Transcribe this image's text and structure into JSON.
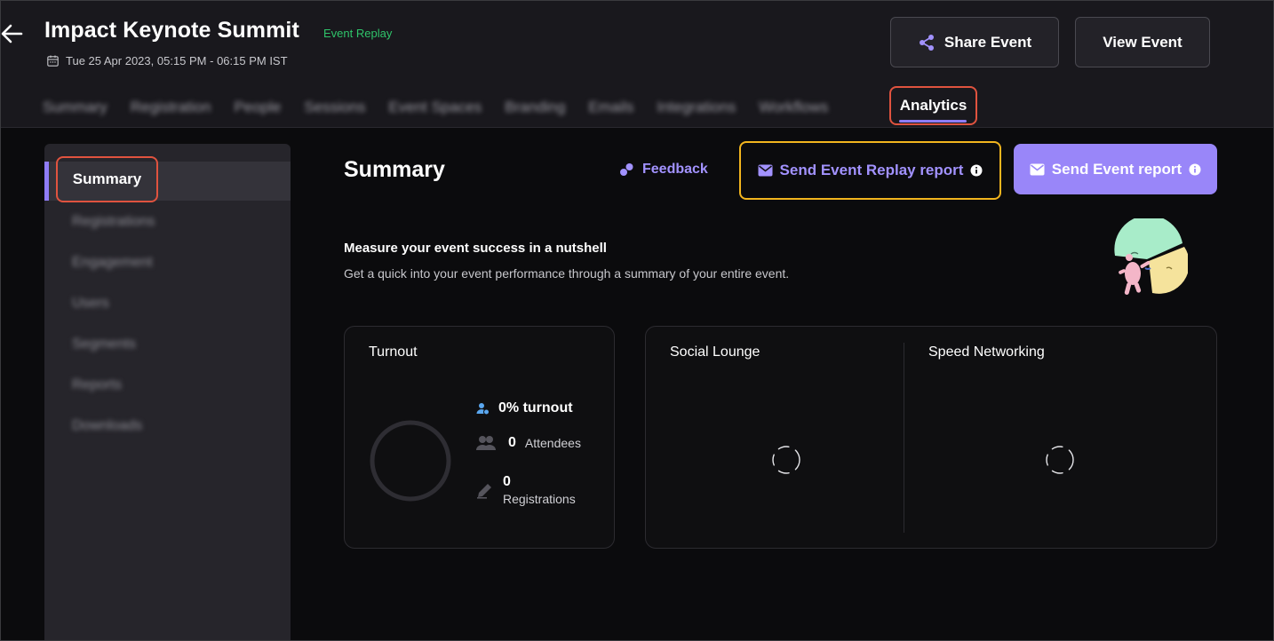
{
  "header": {
    "title": "Impact Keynote Summit",
    "replay_tag": "Event Replay",
    "date_range": "Tue 25 Apr 2023, 05:15 PM - 06:15 PM IST",
    "share_label": "Share Event",
    "view_label": "View Event"
  },
  "tabs": {
    "items": [
      "Summary",
      "Registration",
      "People",
      "Sessions",
      "Event Spaces",
      "Branding",
      "Emails",
      "Integrations",
      "Workflows"
    ],
    "active": "Analytics"
  },
  "subnav": {
    "active": "Summary",
    "items": [
      "Registrations",
      "Engagement",
      "Users",
      "Segments",
      "Reports",
      "Downloads"
    ]
  },
  "main": {
    "title": "Summary",
    "feedback_label": "Feedback",
    "replay_report_label": "Send Event Replay report",
    "event_report_label": "Send Event report",
    "measure_title": "Measure your event success in a nutshell",
    "measure_sub": "Get a quick into your event performance through a summary of your entire event."
  },
  "turnout": {
    "title": "Turnout",
    "turnout_text": "0% turnout",
    "attendees_count": "0",
    "attendees_label": "Attendees",
    "registrations_count": "0",
    "registrations_label": "Registrations"
  },
  "networking": {
    "social_title": "Social Lounge",
    "speed_title": "Speed Networking"
  },
  "colors": {
    "accent": "#8f7cf7",
    "highlight_red": "#e0533f",
    "highlight_yellow": "#f2b51e",
    "replay_green": "#2fc36a"
  }
}
